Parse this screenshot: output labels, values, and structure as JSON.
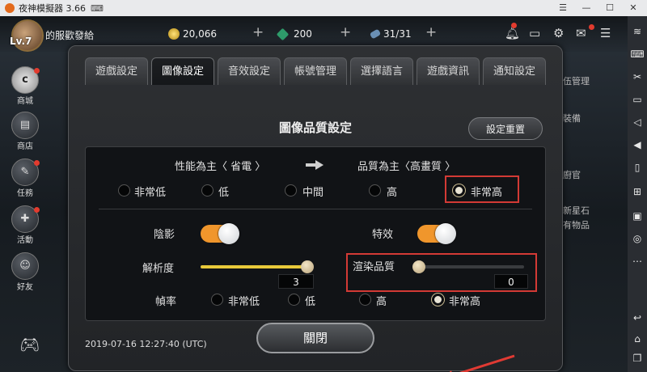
{
  "window": {
    "title": "夜神模擬器 3.66",
    "titlebar_icons": [
      "gamepad-icon",
      "menu-icon",
      "minimize-icon",
      "maximize-icon",
      "close-icon"
    ]
  },
  "hud": {
    "level": "Lv.7",
    "player_name": "的服歡發給",
    "gold": "20,066",
    "gems": "200",
    "stamina": "31/31",
    "plus": "+"
  },
  "left_menu": {
    "items": [
      {
        "label": "商城",
        "icon": "c"
      },
      {
        "label": "商店",
        "icon": "chest-icon"
      },
      {
        "label": "任務",
        "icon": "scroll-icon"
      },
      {
        "label": "活動",
        "icon": "gift-icon"
      },
      {
        "label": "好友",
        "icon": "add-friend-icon"
      }
    ]
  },
  "right_labels": [
    "伍管理",
    "裝備",
    "廚官",
    "新星石",
    "有物品"
  ],
  "settings": {
    "tabs": [
      {
        "label": "遊戲設定",
        "active": false
      },
      {
        "label": "圖像設定",
        "active": true
      },
      {
        "label": "音效設定",
        "active": false
      },
      {
        "label": "帳號管理",
        "active": false
      },
      {
        "label": "選擇語言",
        "active": false
      },
      {
        "label": "遊戲資訊",
        "active": false
      },
      {
        "label": "通知設定",
        "active": false
      }
    ],
    "title": "圖像品質設定",
    "reset_label": "設定重置",
    "performance_label": "性能為主〈 省電 〉",
    "quality_label": "品質為主〈高畫質 〉",
    "quality_options": [
      "非常低",
      "低",
      "中間",
      "高",
      "非常高"
    ],
    "quality_selected": "非常高",
    "shadow_label": "陰影",
    "shadow_on": true,
    "effects_label": "特效",
    "effects_on": true,
    "resolution_label": "解析度",
    "resolution_value": "3",
    "resolution_fraction": 1.0,
    "render_label": "渲染品質",
    "render_value": "0",
    "render_fraction": 0.0,
    "framerate_label": "幀率",
    "framerate_options": [
      "非常低",
      "低",
      "高",
      "非常高"
    ],
    "framerate_selected": "非常高",
    "close_label": "關閉",
    "timestamp": "2019-07-16  12:27:40 (UTC)"
  },
  "colors": {
    "accent_orange": "#f0962c",
    "slider_yellow": "#e8c93a",
    "highlight_red": "#d33a35"
  }
}
